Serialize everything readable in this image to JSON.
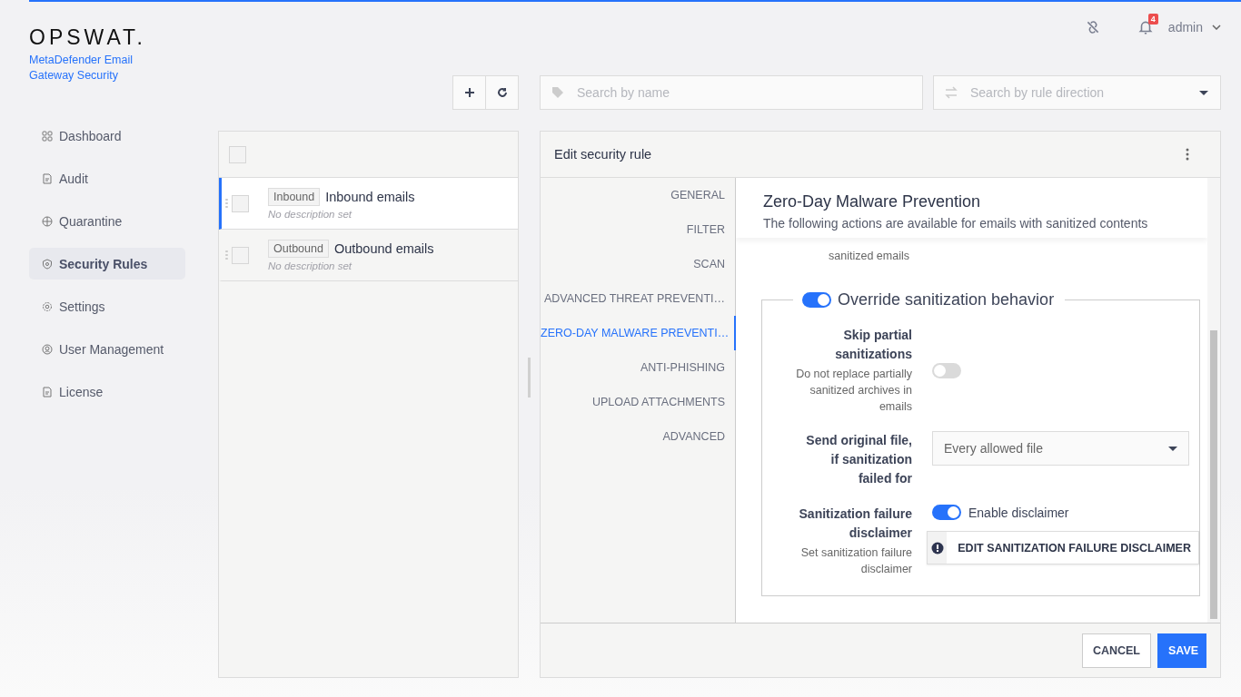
{
  "brand": {
    "logo": "OPSWAT.",
    "product": "MetaDefender Email Gateway Security"
  },
  "topbar": {
    "notifications": "4",
    "user": "admin"
  },
  "sidebar": {
    "items": [
      {
        "label": "Dashboard",
        "selected": false
      },
      {
        "label": "Audit",
        "selected": false
      },
      {
        "label": "Quarantine",
        "selected": false
      },
      {
        "label": "Security Rules",
        "selected": true
      },
      {
        "label": "Settings",
        "selected": false
      },
      {
        "label": "User Management",
        "selected": false
      },
      {
        "label": "License",
        "selected": false
      }
    ]
  },
  "select_all": {
    "checked": false
  },
  "search": {
    "name_placeholder": "Search by name",
    "direction_placeholder": "Search by rule direction"
  },
  "rules": [
    {
      "tag": "Inbound",
      "name": "Inbound emails",
      "description": "No description set",
      "selected": true,
      "checked": false
    },
    {
      "tag": "Outbound",
      "name": "Outbound emails",
      "description": "No description set",
      "selected": false,
      "checked": false
    }
  ],
  "editor": {
    "title": "Edit security rule",
    "sections": [
      {
        "label": "GENERAL",
        "selected": false
      },
      {
        "label": "FILTER",
        "selected": false
      },
      {
        "label": "SCAN",
        "selected": false
      },
      {
        "label": "ADVANCED THREAT PREVENTI…",
        "selected": false
      },
      {
        "label": "ZERO-DAY MALWARE PREVENTI…",
        "selected": true
      },
      {
        "label": "ANTI-PHISHING",
        "selected": false
      },
      {
        "label": "UPLOAD ATTACHMENTS",
        "selected": false
      },
      {
        "label": "ADVANCED",
        "selected": false
      }
    ],
    "heading": "Zero-Day Malware Prevention",
    "subheading": "The following actions are available for emails with sanitized contents",
    "partial_row": "sanitized emails",
    "override": {
      "label": "Override sanitization behavior",
      "on": true
    },
    "fields": [
      {
        "kind": "toggle",
        "label": "Skip partial sanitizations",
        "hint": "Do not replace partially sanitized archives in emails",
        "on": false
      },
      {
        "kind": "select",
        "label": "Send original file, if sanitization failed for",
        "value": "Every allowed file"
      },
      {
        "kind": "disclaimer",
        "label": "Sanitization failure disclaimer",
        "hint": "Set sanitization failure disclaimer",
        "on": true,
        "toggle_label": "Enable disclaimer",
        "button": "EDIT SANITIZATION FAILURE DISCLAIMER"
      }
    ],
    "buttons": {
      "cancel": "CANCEL",
      "save": "SAVE"
    }
  }
}
